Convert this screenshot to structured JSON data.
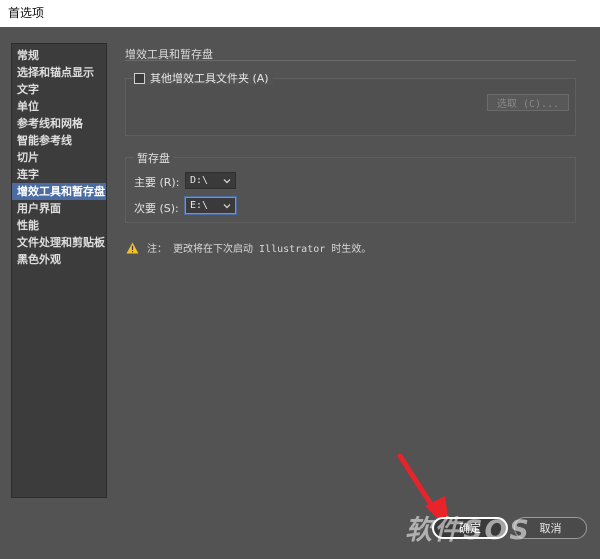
{
  "window": {
    "title": "首选项"
  },
  "sidebar": {
    "items": [
      {
        "label": "常规",
        "selected": false
      },
      {
        "label": "选择和锚点显示",
        "selected": false
      },
      {
        "label": "文字",
        "selected": false
      },
      {
        "label": "单位",
        "selected": false
      },
      {
        "label": "参考线和网格",
        "selected": false
      },
      {
        "label": "智能参考线",
        "selected": false
      },
      {
        "label": "切片",
        "selected": false
      },
      {
        "label": "连字",
        "selected": false
      },
      {
        "label": "增效工具和暂存盘",
        "selected": true
      },
      {
        "label": "用户界面",
        "selected": false
      },
      {
        "label": "性能",
        "selected": false
      },
      {
        "label": "文件处理和剪贴板",
        "selected": false
      },
      {
        "label": "黑色外观",
        "selected": false
      }
    ]
  },
  "main": {
    "section_title": "增效工具和暂存盘",
    "plugins": {
      "checkbox_label": "其他增效工具文件夹 (A)",
      "checked": false,
      "choose_button": "选取 (C)..."
    },
    "scratch": {
      "title": "暂存盘",
      "primary_label": "主要 (R):",
      "primary_value": "D:\\",
      "secondary_label": "次要 (S):",
      "secondary_value": "E:\\"
    },
    "note": {
      "icon": "warning-icon",
      "text": "注： 更改将在下次启动 Illustrator 时生效。"
    }
  },
  "footer": {
    "ok_label": "确定",
    "cancel_label": "取消"
  },
  "overlay": {
    "watermark": "软件SOS",
    "arrow_color": "#e8232a"
  }
}
